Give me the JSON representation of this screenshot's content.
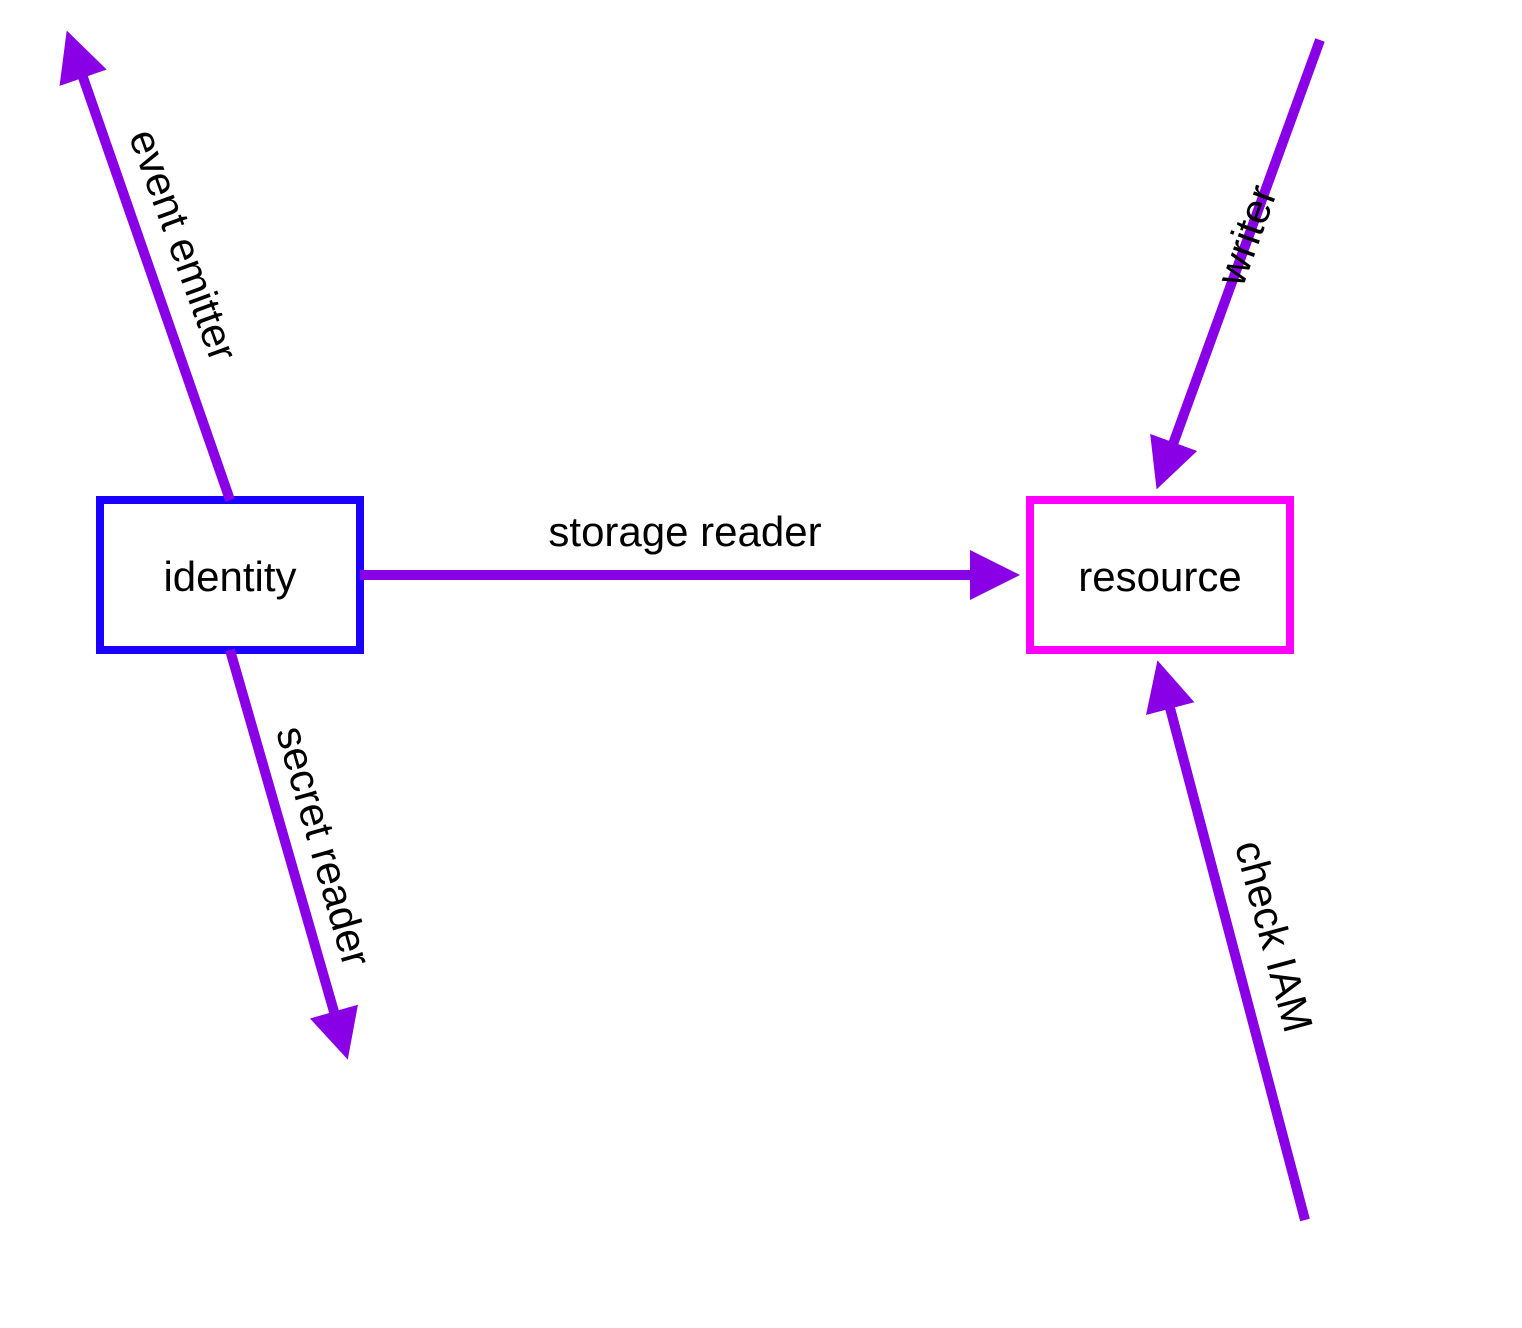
{
  "colors": {
    "identity_stroke": "#1a00ff",
    "resource_stroke": "#ff00ff",
    "arrow": "#8a00e6"
  },
  "nodes": {
    "identity": {
      "label": "identity"
    },
    "resource": {
      "label": "resource"
    }
  },
  "edges": {
    "storage_reader": {
      "label": "storage reader"
    },
    "event_emitter": {
      "label": "event emitter"
    },
    "secret_reader": {
      "label": "secret reader"
    },
    "writer": {
      "label": "writer"
    },
    "check_iam": {
      "label": "check IAM"
    }
  }
}
